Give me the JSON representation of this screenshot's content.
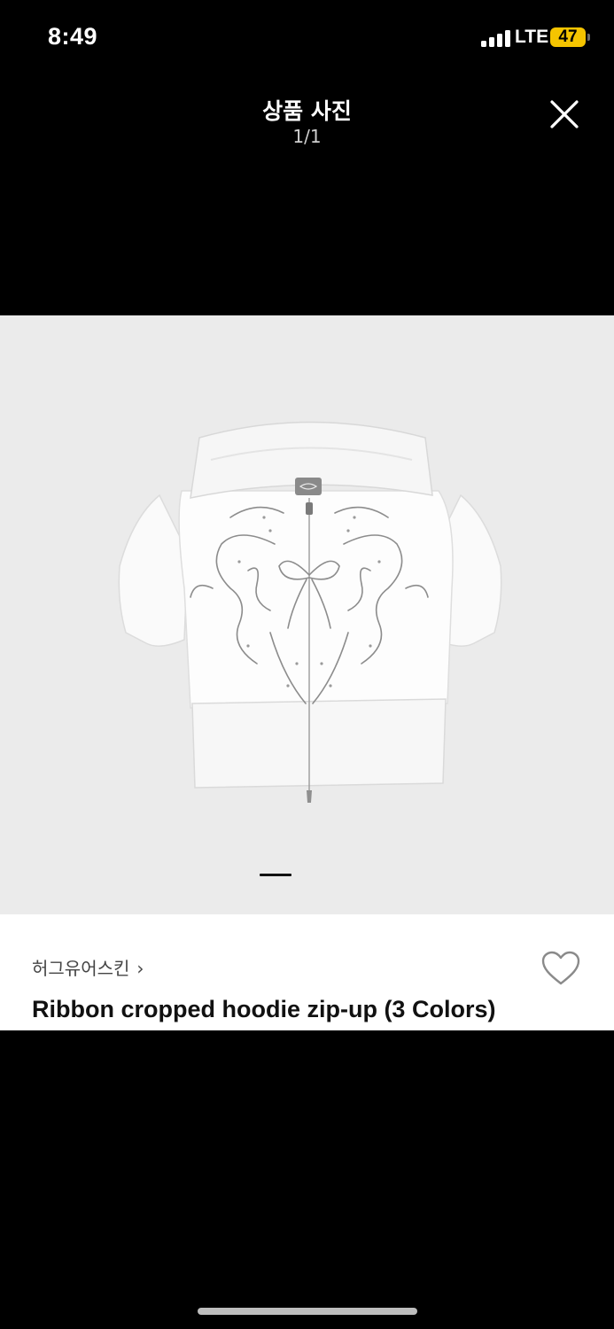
{
  "status_bar": {
    "time": "8:49",
    "network": "LTE",
    "battery_level": "47",
    "battery_color": "#f5c400"
  },
  "header": {
    "title": "상품 사진",
    "page_counter": "1/1",
    "close_icon": "close-icon"
  },
  "photo": {
    "background_color": "#ebebeb",
    "indicator_icon": "carousel-indicator"
  },
  "product": {
    "brand": "허그유어스킨",
    "brand_chevron": "›",
    "name": "Ribbon cropped hoodie zip-up (3 Colors)",
    "wishlist_icon": "heart-outline-icon"
  }
}
